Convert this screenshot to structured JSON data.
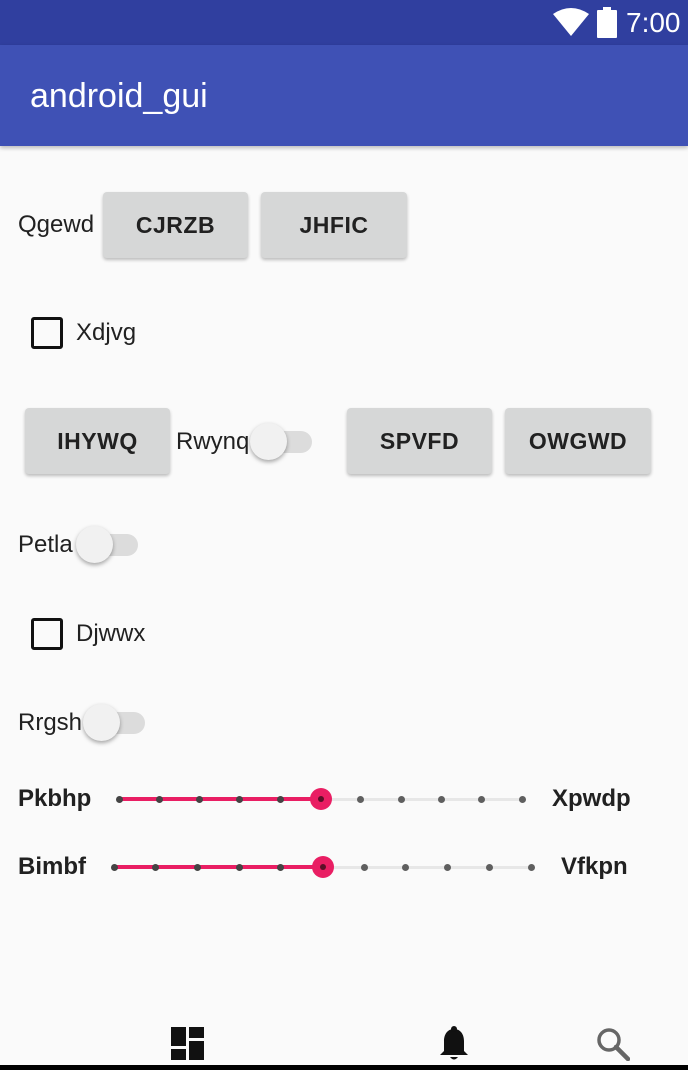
{
  "status_bar": {
    "time": "7:00",
    "icons": [
      "wifi-icon",
      "battery-icon"
    ]
  },
  "app_bar": {
    "title": "android_gui"
  },
  "row1": {
    "label": "Qgewd",
    "button1": "CJRZB",
    "button2": "JHFIC"
  },
  "checkbox1": {
    "label": "Xdjvg",
    "checked": false
  },
  "row3": {
    "button1": "IHYWQ",
    "switch_label": "Rwynq",
    "switch_on": false,
    "button2": "SPVFD",
    "button3": "OWGWD"
  },
  "switch2": {
    "label": "Petla",
    "on": false
  },
  "checkbox2": {
    "label": "Djwwx",
    "checked": false
  },
  "switch3": {
    "label": "Rrgsh",
    "on": false
  },
  "slider1": {
    "left_label": "Pkbhp",
    "right_label": "Xpwdp",
    "value": 5,
    "max": 10
  },
  "slider2": {
    "left_label": "Bimbf",
    "right_label": "Vfkpn",
    "value": 5,
    "max": 10
  },
  "bottom_nav": {
    "items": [
      "dashboard-icon",
      "notifications-icon",
      "search-icon"
    ]
  },
  "colors": {
    "primary": "#3f51b5",
    "primary_dark": "#303f9f",
    "accent": "#e91e63"
  }
}
